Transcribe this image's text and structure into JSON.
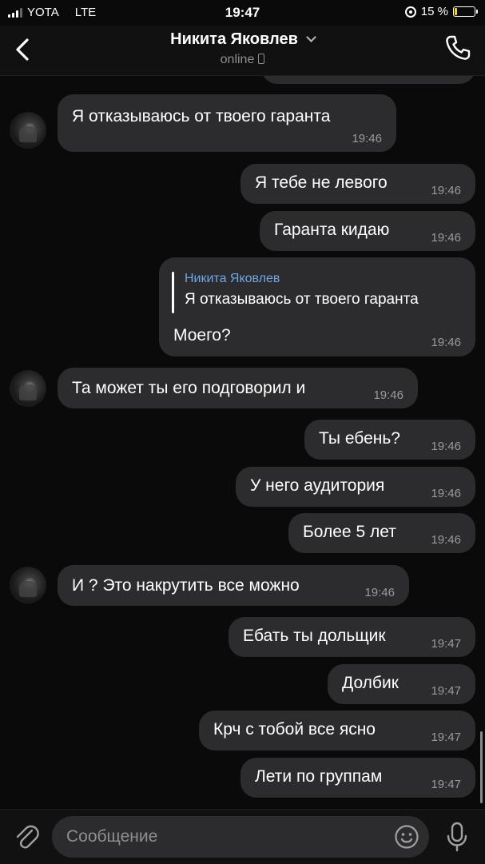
{
  "status": {
    "carrier": "YOTA",
    "network": "LTE",
    "time": "19:47",
    "battery": "15 %",
    "battery_level": 0.15
  },
  "header": {
    "title": "Никита Яковлев",
    "subtitle": "online"
  },
  "messages": [
    {
      "text": "Я отказываюсь от твоего гаранта",
      "time": "19:46"
    },
    {
      "text": "Я тебе не левого",
      "time": "19:46"
    },
    {
      "text": "Гаранта кидаю",
      "time": "19:46"
    },
    {
      "reply_name": "Никита Яковлев",
      "reply_text": "Я отказываюсь от твоего гаранта",
      "text": "Моего?",
      "time": "19:46"
    },
    {
      "text": "Та может ты его подговорил и",
      "time": "19:46"
    },
    {
      "text": "Ты ебень?",
      "time": "19:46"
    },
    {
      "text": "У него аудитория",
      "time": "19:46"
    },
    {
      "text": "Более 5 лет",
      "time": "19:46"
    },
    {
      "text": "И ? Это накрутить все можно",
      "time": "19:46"
    },
    {
      "text": "Ебать ты дольщик",
      "time": "19:47"
    },
    {
      "text": "Долбик",
      "time": "19:47"
    },
    {
      "text": "Крч с тобой все ясно",
      "time": "19:47"
    },
    {
      "text": "Лети по группам",
      "time": "19:47"
    }
  ],
  "input": {
    "placeholder": "Сообщение"
  },
  "colors": {
    "bubble": "#2c2c2e",
    "reply_name": "#6fa7e6",
    "background": "#0a0a0a"
  }
}
